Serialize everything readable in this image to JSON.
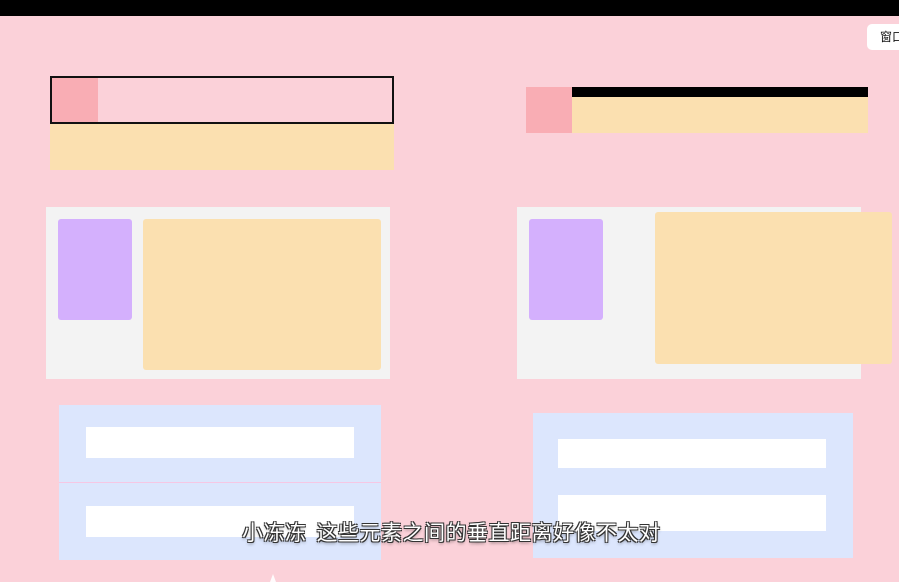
{
  "window": {
    "button_label": "窗口"
  },
  "subtitle": {
    "speaker": "小冻冻",
    "text": "这些元素之间的垂直距离好像不太对"
  },
  "colors": {
    "background": "#fbd1d9",
    "pink_block": "#f9adb4",
    "yellow_block": "#fbe0b0",
    "purple_block": "#d4b0fd",
    "card_bg": "#f3f3f3",
    "blue_panel": "#dce6fd",
    "white_bar": "#ffffff"
  }
}
